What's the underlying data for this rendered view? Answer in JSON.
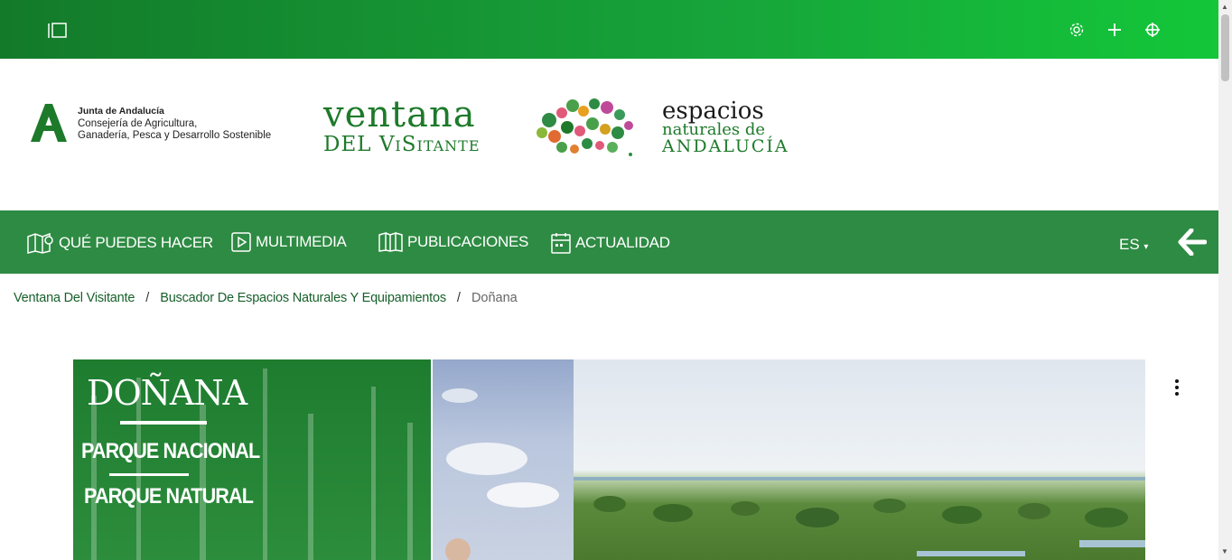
{
  "topbar": {
    "icons": [
      "sidebar-toggle-icon",
      "gear-icon",
      "plus-icon",
      "crosshair-icon"
    ]
  },
  "header": {
    "junta": {
      "org": "Junta de Andalucía",
      "line1": "Consejería de Agricultura,",
      "line2": "Ganadería, Pesca y Desarrollo Sostenible"
    },
    "ventana": {
      "line1": "ventana",
      "line2": "DEL ViSitante"
    },
    "espacios": {
      "line1": "espacios",
      "line2": "naturales de",
      "line3": "ANDALUCÍA"
    }
  },
  "nav": {
    "items": [
      {
        "label": "QUÉ PUEDES HACER",
        "icon": "map-pin-icon"
      },
      {
        "label": "MULTIMEDIA",
        "icon": "play-icon"
      },
      {
        "label": "PUBLICACIONES",
        "icon": "book-icon"
      },
      {
        "label": "ACTUALIDAD",
        "icon": "calendar-icon"
      }
    ],
    "lang": "ES",
    "back_icon": "arrow-left-icon"
  },
  "breadcrumb": {
    "items": [
      "Ventana Del Visitante",
      "Buscador De Espacios Naturales Y Equipamientos"
    ],
    "current": "Doñana",
    "separator": "/"
  },
  "hero": {
    "title": "DOÑANA",
    "subtitle1": "PARQUE NACIONAL",
    "subtitle2": "PARQUE NATURAL"
  },
  "colors": {
    "nav_green": "#2e8b43",
    "topbar_start": "#137a2a",
    "topbar_end": "#13c739",
    "brand_green": "#1d7a2a"
  }
}
